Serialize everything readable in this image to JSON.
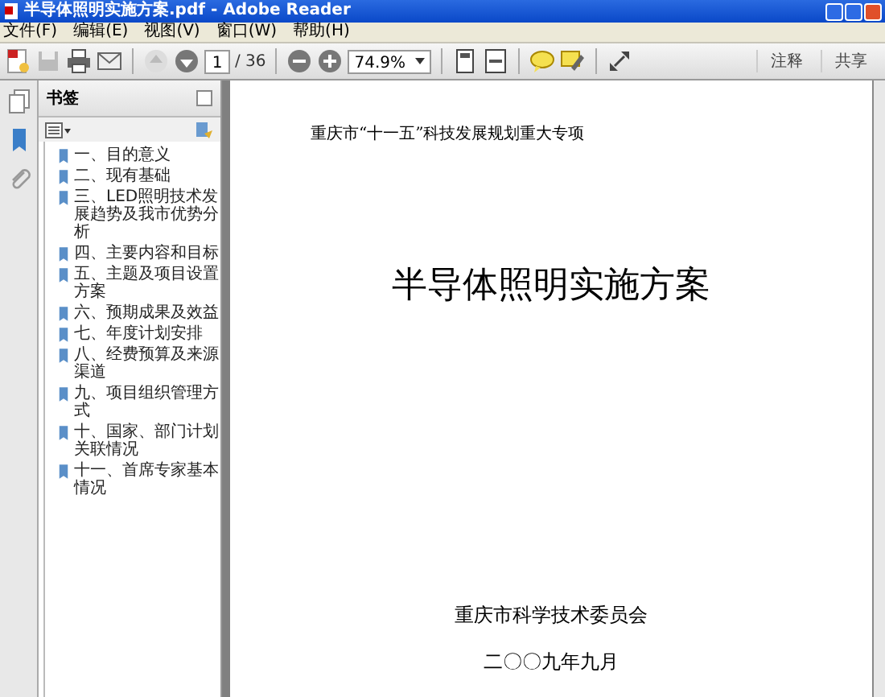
{
  "window": {
    "title": "半导体照明实施方案.pdf - Adobe Reader"
  },
  "menu": [
    "文件(F)",
    "编辑(E)",
    "视图(V)",
    "窗口(W)",
    "帮助(H)"
  ],
  "toolbar": {
    "page": "1",
    "page_count": "/ 36",
    "zoom": "74.9%",
    "right_tabs": [
      "注释",
      "共享"
    ]
  },
  "bookmarks": {
    "title": "书签",
    "items": [
      "一、目的意义",
      "二、现有基础",
      "三、LED照明技术发展趋势及我市优势分析",
      "四、主要内容和目标",
      "五、主题及项目设置方案",
      "六、预期成果及效益",
      "七、年度计划安排",
      "八、经费预算及来源渠道",
      "九、项目组织管理方式",
      "十、国家、部门计划关联情况",
      "十一、首席专家基本情况"
    ]
  },
  "document": {
    "header": "重庆市“十一五”科技发展规划重大专项",
    "title": "半导体照明实施方案",
    "issuer": "重庆市科学技术委员会",
    "date": "二〇〇九年九月"
  }
}
